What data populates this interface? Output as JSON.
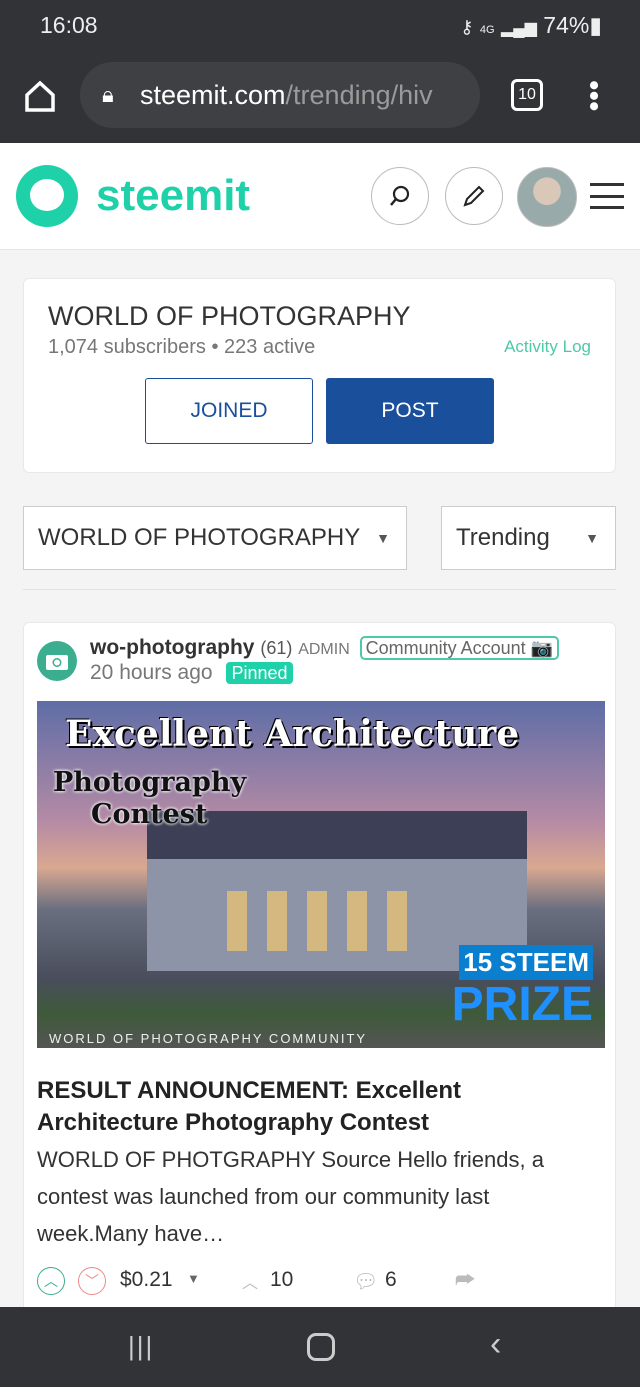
{
  "status_bar": {
    "time": "16:08",
    "battery": "74%",
    "network": "4G"
  },
  "browser": {
    "url_host": "steemit.com",
    "url_path": "/trending/hiv",
    "tab_count": "10"
  },
  "header": {
    "logo": "steemit"
  },
  "community": {
    "title": "WORLD OF PHOTOGRAPHY",
    "subscribers": "1,074 subscribers",
    "separator": "•",
    "active": "223 active",
    "activity_log": "Activity Log",
    "joined_label": "JOINED",
    "post_label": "POST"
  },
  "filters": {
    "community_select": "WORLD OF PHOTOGRAPHY",
    "sort_select": "Trending"
  },
  "post": {
    "author": "wo-photography",
    "reputation": "(61)",
    "role": "ADMIN",
    "badge": "Community Account",
    "time": "20 hours ago",
    "pinned": "Pinned",
    "image": {
      "line1": "Excellent Architecture",
      "line2": "Photography",
      "line3": "Contest",
      "prize1": "15 STEEM",
      "prize2": "PRIZE",
      "footer": "WORLD OF PHOTOGRAPHY COMMUNITY"
    },
    "title": "RESULT ANNOUNCEMENT: Excellent Architecture Photography Contest",
    "excerpt": "WORLD OF PHOTGRAPHY Source Hello friends, a contest was launched from our community last week.Many have…",
    "payout": "$0.21",
    "votes": "10",
    "comments": "6"
  },
  "colors": {
    "accent": "#1fd1a8",
    "post_button": "#1a4f9c",
    "dark_bar": "#323336"
  }
}
